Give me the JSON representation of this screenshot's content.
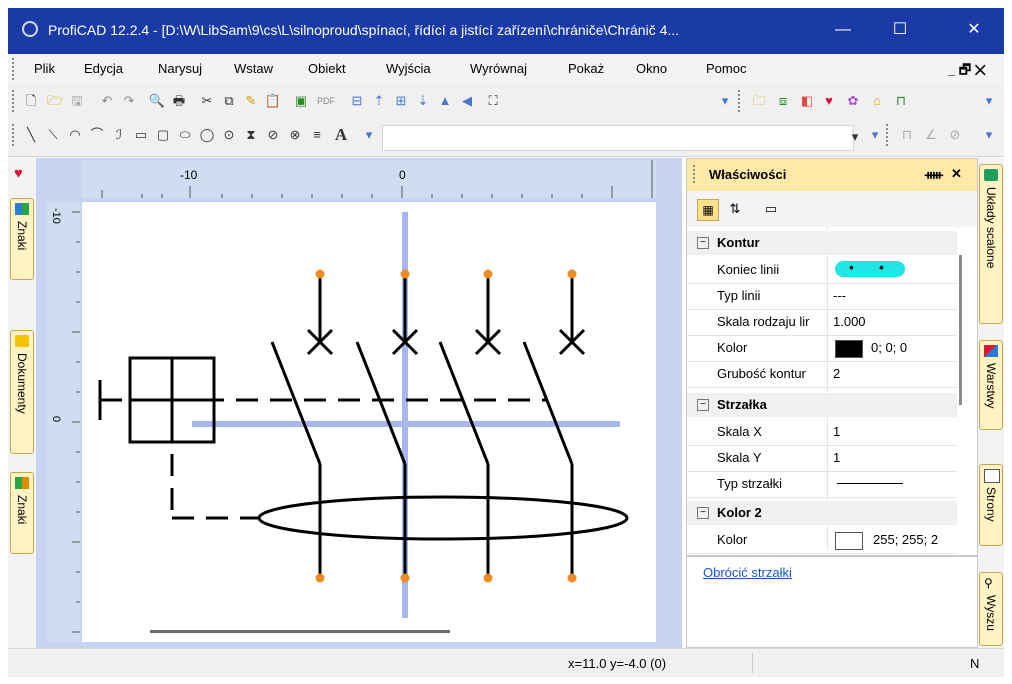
{
  "window": {
    "title": "ProfiCAD 12.2.4 - [D:\\W\\LibSam\\9\\cs\\L\\silnoproud\\spínací, řídící a jistící zařízení\\chrániče\\Chránič 4...",
    "minimize": "—",
    "maximize": "☐",
    "close": "✕"
  },
  "menu": {
    "items": [
      "Plik",
      "Edycja",
      "Narysuj",
      "Wstaw",
      "Obiekt",
      "Wyjścia",
      "Wyrównaj",
      "Pokaż",
      "Okno",
      "Pomoc"
    ],
    "right_controls": "_ 🗗 ✕"
  },
  "toolbar": {
    "pdf_label": "PDF",
    "text_tool": "A"
  },
  "left_tabs": [
    {
      "label": "Znaki",
      "icon": "symbols-icon"
    },
    {
      "label": "Dokumenty",
      "icon": "folder-icon"
    },
    {
      "label": "Znaki",
      "icon": "symbols-icon"
    }
  ],
  "ruler": {
    "h_labels": [
      "-10",
      "0"
    ],
    "v_labels": [
      "-10",
      "0"
    ]
  },
  "properties": {
    "title": "Właściwości",
    "pin": "ᚔ",
    "close": "✕",
    "sections": [
      {
        "name": "Kontur",
        "rows": [
          {
            "name": "Koniec linii",
            "value": ""
          },
          {
            "name": "Typ linii",
            "value": "---"
          },
          {
            "name": "Skala rodzaju lir",
            "value": "1.000"
          },
          {
            "name": "Kolor",
            "value": "0; 0; 0"
          },
          {
            "name": "Grubość kontur",
            "value": "2"
          }
        ]
      },
      {
        "name": "Strzałka",
        "rows": [
          {
            "name": "Skala X",
            "value": "1"
          },
          {
            "name": "Skala Y",
            "value": "1"
          },
          {
            "name": "Typ strzałki",
            "value": ""
          }
        ]
      },
      {
        "name": "Kolor 2",
        "rows": [
          {
            "name": "Kolor",
            "value": "255; 255; 2"
          }
        ]
      }
    ],
    "link": "Obrócić strzałki",
    "colors": {
      "line_end_swatch": "#22e6e6",
      "kolor_swatch": "#000000",
      "kolor2_swatch": "#ffffff"
    }
  },
  "right_tabs": [
    "Układy scalone",
    "Warstwy",
    "Strony",
    "Wyszu"
  ],
  "status": {
    "coords": "x=11.0  y=-4.0 (0)",
    "mode": "N"
  },
  "colors": {
    "title_bar": "#1a3aa6",
    "terminal_dot": "#f08a24",
    "guide_line": "#a9b6ee"
  }
}
